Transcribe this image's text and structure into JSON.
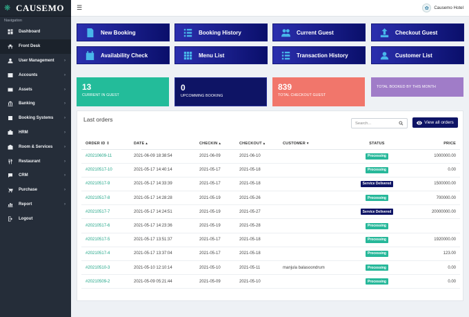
{
  "app": {
    "brand": "CAUSEMO",
    "hotel_name": "Causemo Hotel"
  },
  "sidebar": {
    "heading": "Navigation",
    "items": [
      {
        "label": "Dashboard",
        "icon": "dashboard-icon",
        "has_children": false,
        "active": false
      },
      {
        "label": "Front Desk",
        "icon": "front-desk-icon",
        "has_children": false,
        "active": true
      },
      {
        "label": "User Management",
        "icon": "user-icon",
        "has_children": true,
        "active": false
      },
      {
        "label": "Accounts",
        "icon": "accounts-icon",
        "has_children": true,
        "active": false
      },
      {
        "label": "Assets",
        "icon": "assets-icon",
        "has_children": true,
        "active": false
      },
      {
        "label": "Banking",
        "icon": "bank-icon",
        "has_children": true,
        "active": false
      },
      {
        "label": "Booking Systems",
        "icon": "booking-icon",
        "has_children": true,
        "active": false
      },
      {
        "label": "HRM",
        "icon": "hrm-icon",
        "has_children": true,
        "active": false
      },
      {
        "label": "Room & Services",
        "icon": "room-icon",
        "has_children": true,
        "active": false
      },
      {
        "label": "Restaurant",
        "icon": "restaurant-icon",
        "has_children": true,
        "active": false
      },
      {
        "label": "CRM",
        "icon": "crm-icon",
        "has_children": true,
        "active": false
      },
      {
        "label": "Purchase",
        "icon": "purchase-icon",
        "has_children": true,
        "active": false
      },
      {
        "label": "Report",
        "icon": "report-icon",
        "has_children": true,
        "active": false
      },
      {
        "label": "Logout",
        "icon": "logout-icon",
        "has_children": false,
        "active": false
      }
    ]
  },
  "quick_actions": [
    {
      "label": "New Booking",
      "icon": "booking-doc-icon"
    },
    {
      "label": "Booking History",
      "icon": "list-icon"
    },
    {
      "label": "Current Guest",
      "icon": "users-icon"
    },
    {
      "label": "Checkout Guest",
      "icon": "upload-icon"
    },
    {
      "label": "Availability Check",
      "icon": "calendar-icon"
    },
    {
      "label": "Menu List",
      "icon": "grid-icon"
    },
    {
      "label": "Transaction History",
      "icon": "list-icon"
    },
    {
      "label": "Customer List",
      "icon": "user-icon"
    }
  ],
  "stats": [
    {
      "number": "13",
      "label": "CURRENT IN GUEST"
    },
    {
      "number": "0",
      "label": "UPCOMMING BOOKING"
    },
    {
      "number": "839",
      "label": "TOTAL CHECKOUT GUEST"
    },
    {
      "number": "",
      "label": "TOTAL BOOKED BY THIS MONTH"
    }
  ],
  "orders": {
    "title": "Last orders",
    "search_placeholder": "Search...",
    "view_all_label": "View all orders",
    "columns": {
      "order_id": "ORDER ID",
      "date": "DATE",
      "checkin": "CHECKIN",
      "checkout": "CHECKOUT",
      "customer": "CUSTOMER",
      "status": "STATUS",
      "price": "PRICE"
    },
    "rows": [
      {
        "order_id": "#20210609-11",
        "date": "2021-06-09 18:38:54",
        "checkin": "2021-06-09",
        "checkout": "2021-06-10",
        "customer": "",
        "status": "Processing",
        "price": "1000000.00"
      },
      {
        "order_id": "#20210517-10",
        "date": "2021-05-17 14:40:14",
        "checkin": "2021-05-17",
        "checkout": "2021-05-18",
        "customer": "",
        "status": "Processing",
        "price": "0.00"
      },
      {
        "order_id": "#20210517-9",
        "date": "2021-05-17 14:33:39",
        "checkin": "2021-05-17",
        "checkout": "2021-05-18",
        "customer": "",
        "status": "Service Delivered",
        "price": "1500000.00"
      },
      {
        "order_id": "#20210517-8",
        "date": "2021-05-17 14:28:28",
        "checkin": "2021-05-19",
        "checkout": "2021-05-26",
        "customer": "",
        "status": "Processing",
        "price": "700000.00"
      },
      {
        "order_id": "#20210517-7",
        "date": "2021-05-17 14:24:51",
        "checkin": "2021-05-19",
        "checkout": "2021-05-27",
        "customer": "",
        "status": "Service Delivered",
        "price": "20000000.00"
      },
      {
        "order_id": "#20210517-6",
        "date": "2021-05-17 14:23:36",
        "checkin": "2021-05-19",
        "checkout": "2021-05-28",
        "customer": "",
        "status": "Processing",
        "price": ""
      },
      {
        "order_id": "#20210517-5",
        "date": "2021-05-17 13:51:37",
        "checkin": "2021-05-17",
        "checkout": "2021-05-18",
        "customer": "",
        "status": "Processing",
        "price": "1920000.00"
      },
      {
        "order_id": "#20210517-4",
        "date": "2021-05-17 13:37:04",
        "checkin": "2021-05-17",
        "checkout": "2021-05-18",
        "customer": "",
        "status": "Processing",
        "price": "123.00"
      },
      {
        "order_id": "#20210510-3",
        "date": "2021-05-10 12:10:14",
        "checkin": "2021-05-10",
        "checkout": "2021-05-11",
        "customer": "manjula balasoondrum",
        "status": "Processing",
        "price": "0.00"
      },
      {
        "order_id": "#20210509-2",
        "date": "2021-05-09 05:21:44",
        "checkin": "2021-05-09",
        "checkout": "2021-05-10",
        "customer": "",
        "status": "Processing",
        "price": "0.00"
      }
    ]
  },
  "colors": {
    "sidebar_bg": "#252d39",
    "quick_btn_start": "#2b2fae",
    "quick_btn_end": "#0a0f6b",
    "quick_icon": "#48b6ea",
    "stat_teal": "#23bc9a",
    "stat_navy": "#0e1465",
    "stat_salmon": "#f1766b",
    "stat_purple": "#a07cc8",
    "processing_badge": "#27b89a",
    "delivered_badge": "#0e1465",
    "order_link": "#1ea486"
  }
}
